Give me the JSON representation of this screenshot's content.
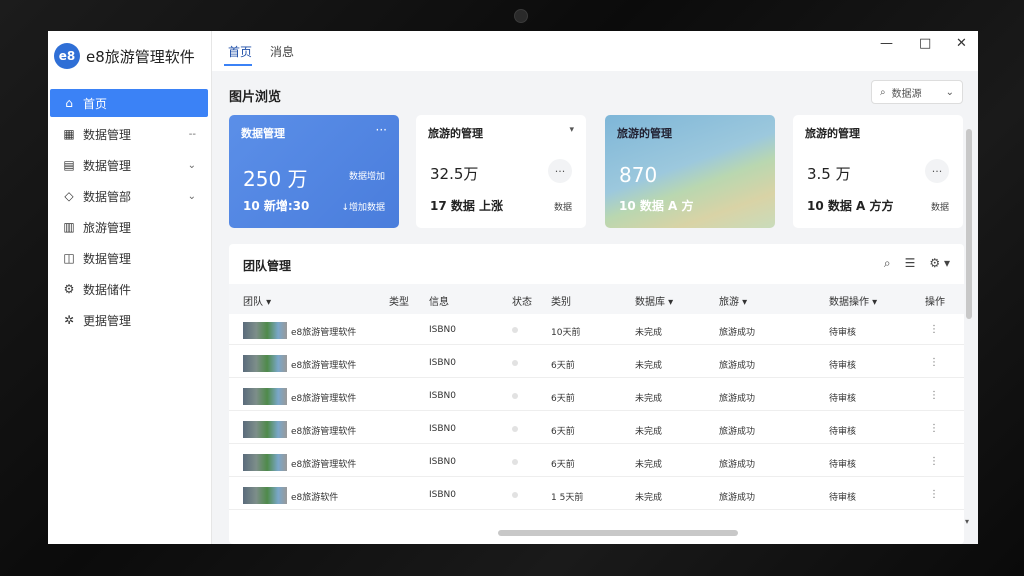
{
  "sidebar": {
    "brand_logo": "e8",
    "brand_name": "e8旅游管理软件",
    "items": [
      {
        "label": "首页",
        "icon": "home-icon",
        "glyph": "⌂",
        "arrow": ""
      },
      {
        "label": "数据管理",
        "icon": "grid-icon",
        "glyph": "▦",
        "arrow": "--"
      },
      {
        "label": "数据管理",
        "icon": "card-icon",
        "glyph": "▤",
        "arrow": "⌄"
      },
      {
        "label": "数据管部",
        "icon": "drop-icon",
        "glyph": "◇",
        "arrow": "⌄"
      },
      {
        "label": "旅游管理",
        "icon": "doc-icon",
        "glyph": "▥",
        "arrow": ""
      },
      {
        "label": "数据管理",
        "icon": "bus-icon",
        "glyph": "◫",
        "arrow": ""
      },
      {
        "label": "数据储件",
        "icon": "gear-icon",
        "glyph": "⚙",
        "arrow": ""
      },
      {
        "label": "更据管理",
        "icon": "settings-icon",
        "glyph": "✲",
        "arrow": ""
      }
    ]
  },
  "topbar": {
    "tabs": [
      "首页",
      "消息"
    ],
    "window_controls": [
      "—",
      "□",
      "✕"
    ]
  },
  "main": {
    "section_title": "图片浏览",
    "search_label": "数据源",
    "cards": [
      {
        "title": "数据管理",
        "value": "250 万",
        "sub": "数据增加",
        "bottom": "10 新增:30",
        "bottom_right": "↓增加数据"
      },
      {
        "title": "旅游的管理",
        "value": "32.5万",
        "bottom": "17 数据 上涨",
        "bottom_right": "数据"
      },
      {
        "title": "旅游的管理",
        "value": "870",
        "bottom": "10 数据 A 方"
      },
      {
        "title": "旅游的管理",
        "value": "3.5 万",
        "bottom": "10 数据 A 方方",
        "bottom_right": "数据"
      }
    ]
  },
  "table": {
    "title": "团队管理",
    "columns": [
      "团队 ▾",
      "类型",
      "信息",
      "状态",
      "类别",
      "数据库 ▾",
      "旅游 ▾",
      "",
      "数据操作 ▾",
      "操作"
    ],
    "rows": [
      {
        "name": "e8旅游管理软件",
        "code": "ISBN0",
        "date": "10天前",
        "type": "未完成",
        "flag": "旅游成功",
        "op": "待审核"
      },
      {
        "name": "e8旅游管理软件",
        "code": "ISBN0",
        "date": "6天前",
        "type": "未完成",
        "flag": "旅游成功",
        "op": "待审核"
      },
      {
        "name": "e8旅游管理软件",
        "code": "ISBN0",
        "date": "6天前",
        "type": "未完成",
        "flag": "旅游成功",
        "op": "待审核"
      },
      {
        "name": "e8旅游管理软件",
        "code": "ISBN0",
        "date": "6天前",
        "type": "未完成",
        "flag": "旅游成功",
        "op": "待审核"
      },
      {
        "name": "e8旅游管理软件",
        "code": "ISBN0",
        "date": "6天前",
        "type": "未完成",
        "flag": "旅游成功",
        "op": "待审核"
      },
      {
        "name": "e8旅游软件",
        "code": "ISBN0",
        "date": "1 5天前",
        "type": "未完成",
        "flag": "旅游成功",
        "op": "待审核"
      }
    ]
  }
}
